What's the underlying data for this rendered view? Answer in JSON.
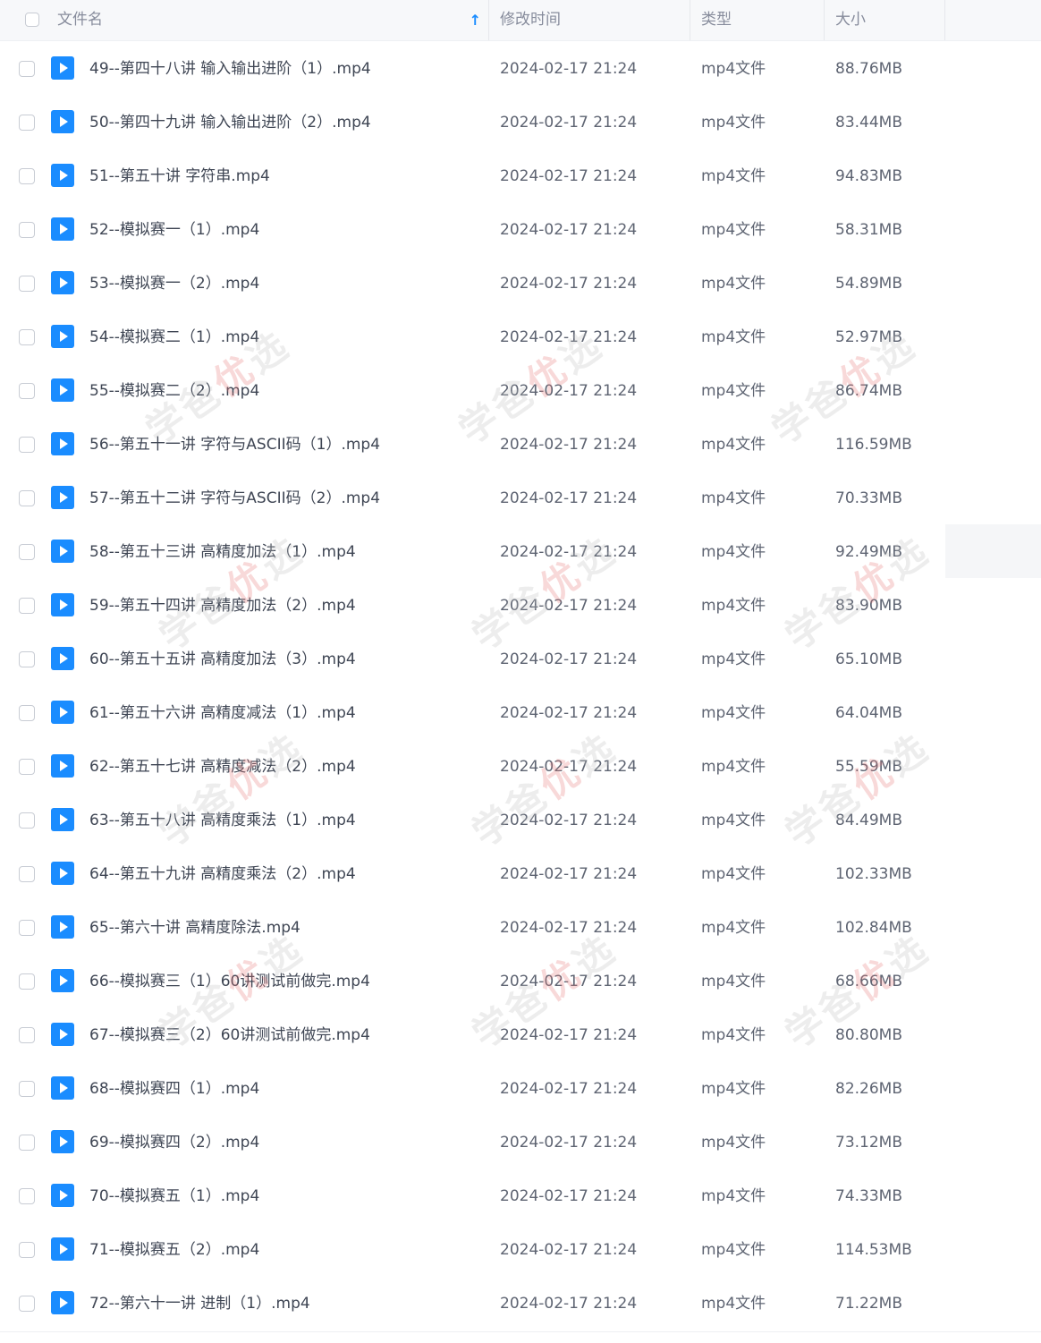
{
  "header": {
    "name_label": "文件名",
    "sort_icon": "↑",
    "time_label": "修改时间",
    "type_label": "类型",
    "size_label": "大小"
  },
  "files": [
    {
      "name": "49--第四十八讲 输入输出进阶（1）.mp4",
      "time": "2024-02-17 21:24",
      "type": "mp4文件",
      "size": "88.76MB"
    },
    {
      "name": "50--第四十九讲 输入输出进阶（2）.mp4",
      "time": "2024-02-17 21:24",
      "type": "mp4文件",
      "size": "83.44MB"
    },
    {
      "name": "51--第五十讲 字符串.mp4",
      "time": "2024-02-17 21:24",
      "type": "mp4文件",
      "size": "94.83MB"
    },
    {
      "name": "52--模拟赛一（1）.mp4",
      "time": "2024-02-17 21:24",
      "type": "mp4文件",
      "size": "58.31MB"
    },
    {
      "name": "53--模拟赛一（2）.mp4",
      "time": "2024-02-17 21:24",
      "type": "mp4文件",
      "size": "54.89MB"
    },
    {
      "name": "54--模拟赛二（1）.mp4",
      "time": "2024-02-17 21:24",
      "type": "mp4文件",
      "size": "52.97MB"
    },
    {
      "name": "55--模拟赛二（2）.mp4",
      "time": "2024-02-17 21:24",
      "type": "mp4文件",
      "size": "86.74MB"
    },
    {
      "name": "56--第五十一讲 字符与ASCII码（1）.mp4",
      "time": "2024-02-17 21:24",
      "type": "mp4文件",
      "size": "116.59MB"
    },
    {
      "name": "57--第五十二讲 字符与ASCII码（2）.mp4",
      "time": "2024-02-17 21:24",
      "type": "mp4文件",
      "size": "70.33MB"
    },
    {
      "name": "58--第五十三讲 高精度加法（1）.mp4",
      "time": "2024-02-17 21:24",
      "type": "mp4文件",
      "size": "92.49MB"
    },
    {
      "name": "59--第五十四讲 高精度加法（2）.mp4",
      "time": "2024-02-17 21:24",
      "type": "mp4文件",
      "size": "83.90MB"
    },
    {
      "name": "60--第五十五讲 高精度加法（3）.mp4",
      "time": "2024-02-17 21:24",
      "type": "mp4文件",
      "size": "65.10MB"
    },
    {
      "name": "61--第五十六讲 高精度减法（1）.mp4",
      "time": "2024-02-17 21:24",
      "type": "mp4文件",
      "size": "64.04MB"
    },
    {
      "name": "62--第五十七讲 高精度减法（2）.mp4",
      "time": "2024-02-17 21:24",
      "type": "mp4文件",
      "size": "55.59MB"
    },
    {
      "name": "63--第五十八讲 高精度乘法（1）.mp4",
      "time": "2024-02-17 21:24",
      "type": "mp4文件",
      "size": "84.49MB"
    },
    {
      "name": "64--第五十九讲 高精度乘法（2）.mp4",
      "time": "2024-02-17 21:24",
      "type": "mp4文件",
      "size": "102.33MB"
    },
    {
      "name": "65--第六十讲 高精度除法.mp4",
      "time": "2024-02-17 21:24",
      "type": "mp4文件",
      "size": "102.84MB"
    },
    {
      "name": "66--模拟赛三（1）60讲测试前做完.mp4",
      "time": "2024-02-17 21:24",
      "type": "mp4文件",
      "size": "68.66MB"
    },
    {
      "name": "67--模拟赛三（2）60讲测试前做完.mp4",
      "time": "2024-02-17 21:24",
      "type": "mp4文件",
      "size": "80.80MB"
    },
    {
      "name": "68--模拟赛四（1）.mp4",
      "time": "2024-02-17 21:24",
      "type": "mp4文件",
      "size": "82.26MB"
    },
    {
      "name": "69--模拟赛四（2）.mp4",
      "time": "2024-02-17 21:24",
      "type": "mp4文件",
      "size": "73.12MB"
    },
    {
      "name": "70--模拟赛五（1）.mp4",
      "time": "2024-02-17 21:24",
      "type": "mp4文件",
      "size": "74.33MB"
    },
    {
      "name": "71--模拟赛五（2）.mp4",
      "time": "2024-02-17 21:24",
      "type": "mp4文件",
      "size": "114.53MB"
    },
    {
      "name": "72--第六十一讲 进制（1）.mp4",
      "time": "2024-02-17 21:24",
      "type": "mp4文件",
      "size": "71.22MB"
    }
  ],
  "watermark": {
    "text_left": "学爸",
    "text_mid": "优",
    "text_right": "选"
  },
  "colors": {
    "accent": "#1a8cff",
    "header_bg": "#f7f8fa",
    "row_hover": "#f5f6f8"
  },
  "icons": {
    "sort": "arrow-up-icon",
    "file": "video-file-icon",
    "checkbox": "checkbox-icon"
  }
}
